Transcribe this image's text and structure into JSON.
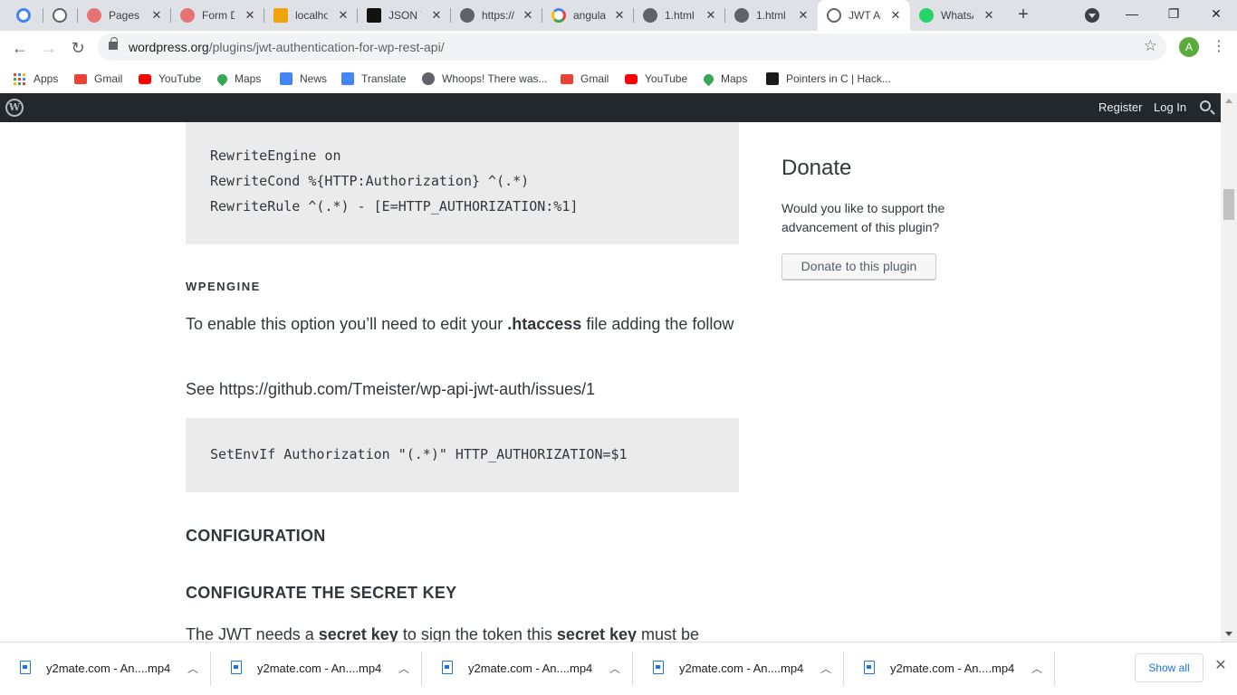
{
  "browser": {
    "tabs": [
      {
        "title": "",
        "icon": "chromium-icon",
        "color": "#4285f4"
      },
      {
        "title": "",
        "icon": "wordpress-icon",
        "color": "#5f6368"
      },
      {
        "title": "Pages ‹",
        "icon": "avatar-icon",
        "color": "#e57373"
      },
      {
        "title": "Form D",
        "icon": "avatar-icon",
        "color": "#e57373"
      },
      {
        "title": "localho",
        "icon": "phpmyadmin-icon",
        "color": "#f0a30a"
      },
      {
        "title": "JSON V",
        "icon": "json-icon",
        "color": "#111111"
      },
      {
        "title": "https://",
        "icon": "globe-icon",
        "color": "#5f6368"
      },
      {
        "title": "angula",
        "icon": "google-icon",
        "color": "#4285f4"
      },
      {
        "title": "1.html",
        "icon": "globe-icon",
        "color": "#5f6368"
      },
      {
        "title": "1.html",
        "icon": "globe-icon",
        "color": "#5f6368"
      },
      {
        "title": "JWT Au",
        "icon": "wordpress-icon",
        "color": "#5f6368",
        "active": true
      },
      {
        "title": "WhatsA",
        "icon": "whatsapp-icon",
        "color": "#25d366"
      }
    ],
    "new_tab": "+",
    "window_controls": {
      "minimize": "—",
      "maximize": "❐",
      "close": "✕"
    },
    "url_host": "wordpress.org",
    "url_path": "/plugins/jwt-authentication-for-wp-rest-api/",
    "profile_initial": "A",
    "bookmarks": [
      {
        "label": "Apps",
        "icon": "apps-grid-icon"
      },
      {
        "label": "Gmail",
        "icon": "gmail-icon",
        "color": "#ea4335"
      },
      {
        "label": "YouTube",
        "icon": "youtube-icon",
        "color": "#ff0000"
      },
      {
        "label": "Maps",
        "icon": "maps-icon",
        "color": "#34a853"
      },
      {
        "label": "News",
        "icon": "news-icon",
        "color": "#4285f4"
      },
      {
        "label": "Translate",
        "icon": "translate-icon",
        "color": "#4285f4"
      },
      {
        "label": "Whoops! There was...",
        "icon": "globe-icon",
        "color": "#5f6368"
      },
      {
        "label": "Gmail",
        "icon": "gmail-icon",
        "color": "#ea4335"
      },
      {
        "label": "YouTube",
        "icon": "youtube-icon",
        "color": "#ff0000"
      },
      {
        "label": "Maps",
        "icon": "maps-icon",
        "color": "#34a853"
      },
      {
        "label": "Pointers in C | Hack...",
        "icon": "hackerrank-icon",
        "color": "#1b1b1b"
      }
    ]
  },
  "wp_bar": {
    "register": "Register",
    "login": "Log In"
  },
  "main": {
    "code1": [
      "RewriteEngine on",
      "RewriteCond %{HTTP:Authorization} ^(.*)",
      "RewriteRule ^(.*) - [E=HTTP_AUTHORIZATION:%1]"
    ],
    "wpengine_heading": "WPENGINE",
    "wpengine_text_pre": "To enable this option you’ll need to edit your ",
    "wpengine_text_bold": ".htaccess",
    "wpengine_text_post": " file adding the follow",
    "see_text": "See https://github.com/Tmeister/wp-api-jwt-auth/issues/1",
    "code2": "SetEnvIf Authorization \"(.*)\" HTTP_AUTHORIZATION=$1",
    "configuration_heading": "CONFIGURATION",
    "secret_key_heading": "CONFIGURATE THE SECRET KEY",
    "jwt_text_1": "The JWT needs a ",
    "jwt_text_bold_1": "secret key",
    "jwt_text_2": " to sign the token this ",
    "jwt_text_bold_2": "secret key",
    "jwt_text_3": " must be"
  },
  "sidebar": {
    "donate_title": "Donate",
    "donate_text": "Would you like to support the advancement of this plugin?",
    "donate_button": "Donate to this plugin"
  },
  "downloads": {
    "items": [
      "y2mate.com - An....mp4",
      "y2mate.com - An....mp4",
      "y2mate.com - An....mp4",
      "y2mate.com - An....mp4",
      "y2mate.com - An....mp4"
    ],
    "show_all": "Show all"
  }
}
